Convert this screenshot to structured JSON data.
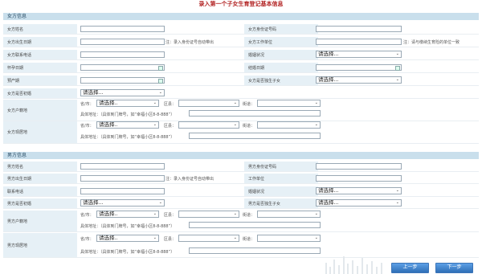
{
  "page_title": "录入第一个子女生育登记基本信息",
  "select_placeholder": "请选择...",
  "select_placeholder_short": "请选择..",
  "female": {
    "header": "女方信息",
    "name_label": "女方姓名",
    "id_label": "女方身份证号码",
    "birth_label": "女方出生日期",
    "birth_note": "注：录入身份证号自动带出",
    "work_label": "女方工作单位",
    "work_note": "注：请与缴纳生育险的单位一致",
    "phone_label": "女方联系电话",
    "marital_label": "婚姻状况",
    "pregnancy_label": "怀孕日期",
    "marriage_date_label": "结婚日期",
    "due_label": "预产期",
    "only_child_label": "女方是否独生子女",
    "first_marriage_label": "女方是否初婚",
    "hukou_label": "女方户籍地",
    "residence_label": "女方现居地",
    "province_label": "省/市：",
    "district_label": "区县：",
    "street_label": "街道：",
    "address_label": "具体地址：（具体到门牌号，如“幸福小区8-8-888”）"
  },
  "male": {
    "header": "男方信息",
    "name_label": "男方姓名",
    "id_label": "男方身份证号码",
    "birth_label": "男方出生日期",
    "birth_note": "注：录入身份证号自动带出",
    "work_label": "工作单位",
    "phone_label": "联系电话",
    "marital_label": "婚姻状况",
    "first_marriage_label": "男方是否初婚",
    "only_child_label": "男方是否独生子女",
    "hukou_label": "男方户籍地",
    "residence_label": "男方现居地",
    "province_label": "省/市：",
    "district_label": "区县：",
    "street_label": "街道：",
    "address_label": "具体地址：（具体到门牌号，如“幸福小区8-8-888”）"
  },
  "buttons": {
    "prev": "上一步",
    "next": "下一步"
  }
}
